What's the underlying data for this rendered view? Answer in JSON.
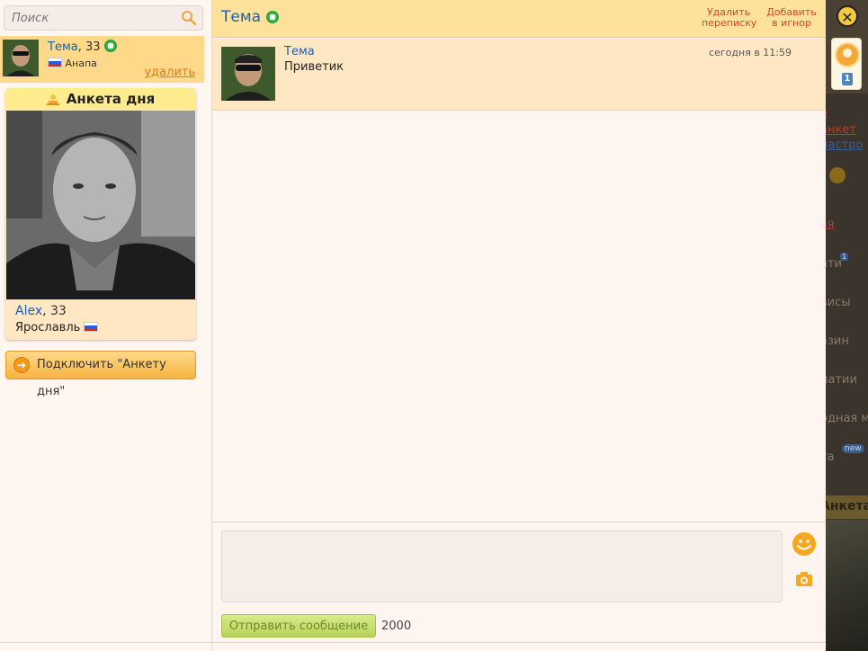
{
  "search": {
    "placeholder": "Поиск"
  },
  "contact": {
    "name": "Тема",
    "age": ", 33",
    "city": "Анапа",
    "delete_label": "удалить"
  },
  "day_profile": {
    "title": "Анкета дня",
    "name": "Alex",
    "age": ", 33",
    "city": "Ярославль",
    "connect_label": "Подключить \"Анкету дня\""
  },
  "chat": {
    "title": "Тема",
    "delete_line1": "Удалить",
    "delete_line2": "переписку",
    "ignore_line1": "Добавить",
    "ignore_line2": "в игнор",
    "messages": [
      {
        "author": "Тема",
        "time": "сегодня в 11:59",
        "text": "Приветик"
      }
    ],
    "composer": {
      "send_label": "Отправить сообщение",
      "char_count": "2000"
    }
  },
  "side_widget": {
    "count": "1"
  },
  "background_fragments": [
    "а",
    "анкет",
    "настро",
    "ья",
    "ати",
    "висы",
    "азин",
    "патии",
    "одная м",
    "та",
    "Анкета"
  ],
  "colors": {
    "accent_blue": "#1a5fb4",
    "header_yellow": "#ffe29a",
    "contact_highlight": "#ffd98a",
    "alert_red": "#d0462a",
    "send_green": "#b6d45a"
  }
}
